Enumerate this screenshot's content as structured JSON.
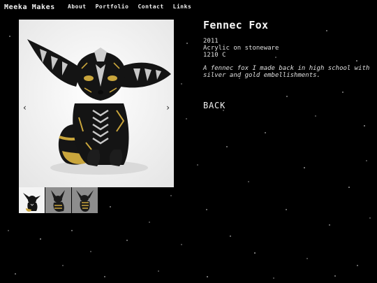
{
  "header": {
    "site_title": "Meeka Makes",
    "nav": [
      {
        "label": "About"
      },
      {
        "label": "Portfolio"
      },
      {
        "label": "Contact"
      },
      {
        "label": "Links"
      }
    ]
  },
  "gallery": {
    "prev_icon": "‹",
    "next_icon": "›",
    "thumbnail_count": 3,
    "active_index": 0
  },
  "artwork": {
    "title": "Fennec Fox",
    "year": "2011",
    "medium": "Acrylic on stoneware",
    "code": "1210 C",
    "description": "A fennec fox I made back in high school with silver and gold embellishments.",
    "back_label": "BACK"
  },
  "colors": {
    "background": "#000000",
    "text": "#e8e8e8",
    "gold": "#c9a53c",
    "silver": "#c8c8c8"
  }
}
